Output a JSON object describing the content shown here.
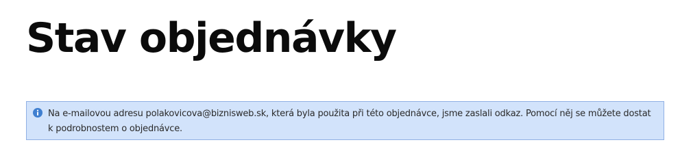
{
  "page": {
    "title": "Stav objednávky"
  },
  "notice": {
    "icon": "info-icon",
    "text": "Na e-mailovou adresu polakovicova@biznisweb.sk, která byla použita při této objednávce, jsme zaslali odkaz. Pomocí něj se můžete dostat k podrobnostem o objednávce.",
    "background_color": "#d2e3fb",
    "border_color": "#8fb0e4",
    "icon_color": "#3f7fd0"
  }
}
